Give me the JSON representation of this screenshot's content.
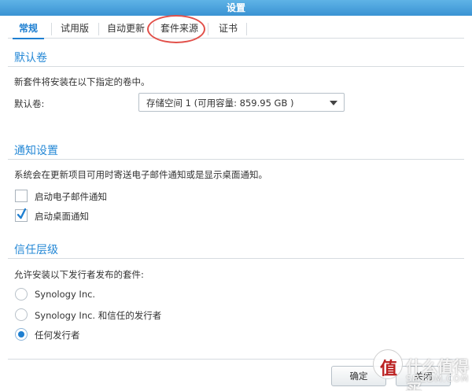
{
  "window": {
    "title": "设置"
  },
  "tabs": [
    {
      "label": "常规",
      "active": true
    },
    {
      "label": "试用版",
      "active": false
    },
    {
      "label": "自动更新",
      "active": false
    },
    {
      "label": "套件来源",
      "active": false
    },
    {
      "label": "证书",
      "active": false
    }
  ],
  "default_volume": {
    "section_title": "默认卷",
    "description": "新套件将安装在以下指定的卷中。",
    "field_label": "默认卷:",
    "selected_value": "存储空间 1 (可用容量:  859.95 GB )"
  },
  "notification": {
    "section_title": "通知设置",
    "description": "系统会在更新项目可用时寄送电子邮件通知或是显示桌面通知。",
    "options": [
      {
        "label": "启动电子邮件通知",
        "checked": false
      },
      {
        "label": "启动桌面通知",
        "checked": true
      }
    ]
  },
  "trust": {
    "section_title": "信任层级",
    "description": "允许安装以下发行者发布的套件:",
    "options": [
      {
        "label": "Synology Inc.",
        "selected": false
      },
      {
        "label": "Synology Inc. 和信任的发行者",
        "selected": false
      },
      {
        "label": "任何发行者",
        "selected": true
      }
    ]
  },
  "footer": {
    "ok_label": "确定",
    "close_label": "关闭"
  },
  "watermark": {
    "text": "什么值得买",
    "sub": "SMZDM.COM"
  },
  "colors": {
    "accent": "#1e7fd1",
    "titlebar": "#3a93d3",
    "highlight": "#e2504a"
  }
}
